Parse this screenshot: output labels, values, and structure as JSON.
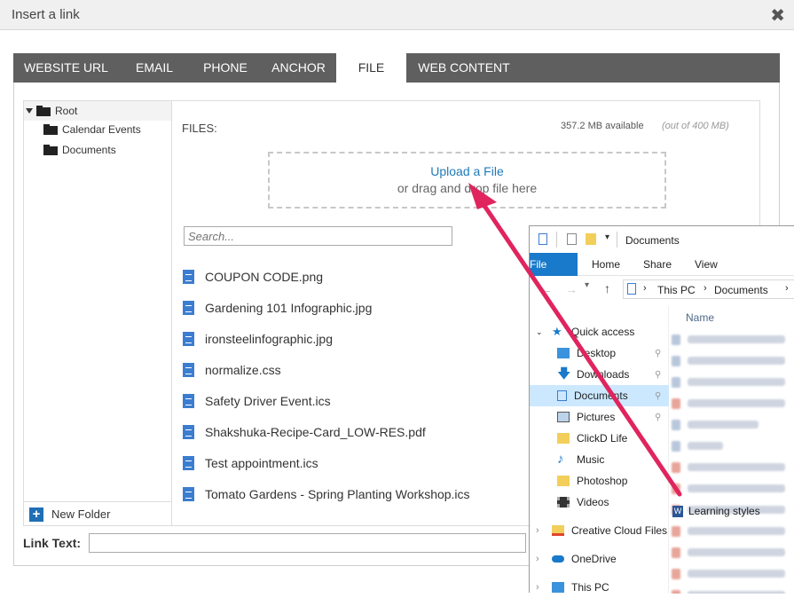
{
  "dialog": {
    "title": "Insert a link",
    "close_icon": "close-icon"
  },
  "tabs": [
    "WEBSITE URL",
    "EMAIL",
    "PHONE",
    "ANCHOR",
    "FILE",
    "WEB CONTENT"
  ],
  "active_tab": "FILE",
  "tree": {
    "root": "Root",
    "children": [
      "Calendar Events",
      "Documents"
    ],
    "new_folder": "New Folder"
  },
  "files": {
    "label": "FILES:",
    "available": "357.2 MB available",
    "out_of": "(out of 400 MB)",
    "upload_link": "Upload a File",
    "drag_text": "or drag and drop file here",
    "search_placeholder": "Search...",
    "items": [
      "COUPON CODE.png",
      "Gardening 101 Infographic.jpg",
      "ironsteelinfographic.jpg",
      "normalize.css",
      "Safety Driver Event.ics",
      "Shakshuka-Recipe-Card_LOW-RES.pdf",
      "Test appointment.ics",
      "Tomato Gardens - Spring Planting Workshop.ics"
    ]
  },
  "link_text": {
    "label": "Link Text:",
    "value": ""
  },
  "explorer": {
    "title": "Documents",
    "ribbon": [
      "File",
      "Home",
      "Share",
      "View"
    ],
    "address": [
      "This PC",
      "Documents"
    ],
    "column_name": "Name",
    "nav": [
      "Quick access",
      "Desktop",
      "Downloads",
      "Documents",
      "Pictures",
      "ClickD Life",
      "Music",
      "Photoshop",
      "Videos",
      "Creative Cloud Files",
      "OneDrive",
      "This PC"
    ],
    "visible_file": "Learning styles"
  },
  "colors": {
    "tab_bar": "#5f5f5f",
    "link_blue": "#1f7ab8",
    "arrow": "#e0245e",
    "ribbon_file": "#1979ca",
    "nav_selected": "#cce8ff"
  }
}
